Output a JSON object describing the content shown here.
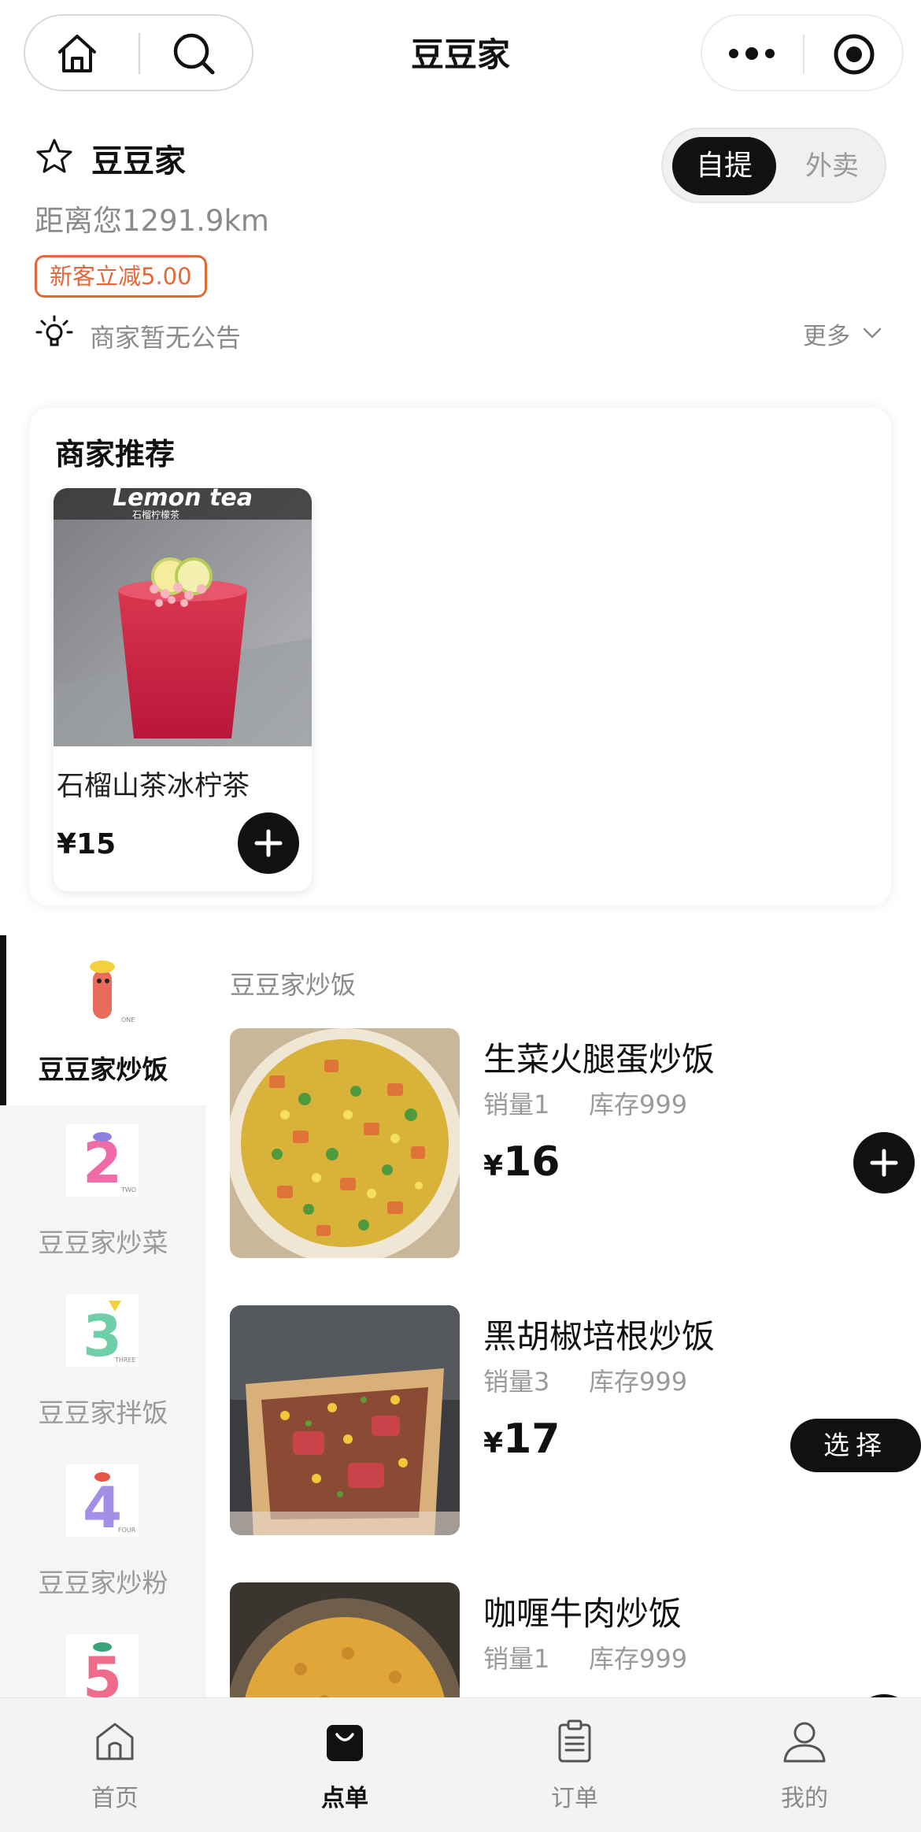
{
  "nav": {
    "title": "豆豆家"
  },
  "shop": {
    "name": "豆豆家",
    "distance": "距离您1291.9km",
    "coupon": "新客立减5.00",
    "notice": "商家暂无公告",
    "more": "更多"
  },
  "mode": {
    "active": "自提",
    "inactive": "外卖"
  },
  "recommend": {
    "title": "商家推荐",
    "items": [
      {
        "name": "石榴山茶冰柠茶",
        "price": "¥15",
        "image_caption": "Lemon tea",
        "image_subcaption": "石榴柠檬茶"
      }
    ]
  },
  "categories": [
    {
      "label": "豆豆家炒饭",
      "number": "1",
      "color": "#e86b5c",
      "active": true
    },
    {
      "label": "豆豆家炒菜",
      "number": "2",
      "color": "#f06ba8",
      "active": false
    },
    {
      "label": "豆豆家拌饭",
      "number": "3",
      "color": "#6ecfa8",
      "active": false
    },
    {
      "label": "豆豆家炒粉",
      "number": "4",
      "color": "#a38ee8",
      "active": false
    },
    {
      "label": "",
      "number": "5",
      "color": "#f06b8a",
      "active": false
    }
  ],
  "list": {
    "section": "豆豆家炒饭",
    "products": [
      {
        "name": "生菜火腿蛋炒饭",
        "sales": "销量1",
        "stock": "库存999",
        "currency": "¥",
        "price": "16",
        "action": "add"
      },
      {
        "name": "黑胡椒培根炒饭",
        "sales": "销量3",
        "stock": "库存999",
        "currency": "¥",
        "price": "17",
        "action": "select",
        "action_label": "选择"
      },
      {
        "name": "咖喱牛肉炒饭",
        "sales": "销量1",
        "stock": "库存999",
        "currency": "¥",
        "price": "",
        "action": "add"
      }
    ]
  },
  "tabs": [
    {
      "label": "首页",
      "icon": "home-icon",
      "active": false
    },
    {
      "label": "点单",
      "icon": "shopping-bag-icon",
      "active": true
    },
    {
      "label": "订单",
      "icon": "clipboard-icon",
      "active": false
    },
    {
      "label": "我的",
      "icon": "user-icon",
      "active": false
    }
  ],
  "colors": {
    "accent": "#111111",
    "coupon": "#e2683a",
    "muted": "#8a8a8a",
    "sidebar_bg": "#f5f5f5",
    "tabbar_bg": "#f2f3f3"
  }
}
